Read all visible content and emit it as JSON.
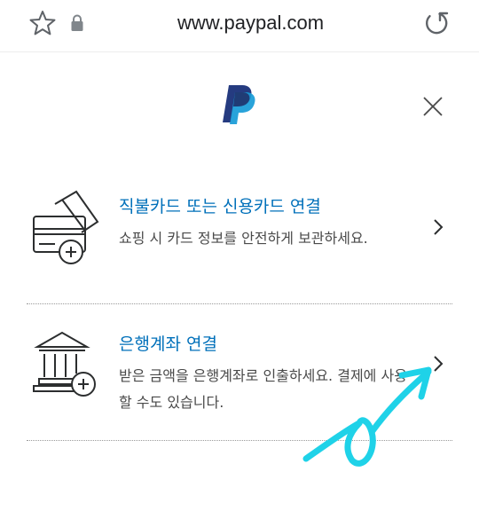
{
  "browser": {
    "url": "www.paypal.com",
    "icons": {
      "favorite": "star-icon",
      "security": "lock-icon",
      "reload": "reload-icon"
    }
  },
  "header": {
    "logo": "paypal-logo",
    "close_icon": "close-icon"
  },
  "options": [
    {
      "title": "직불카드 또는 신용카드 연결",
      "description": "쇼핑 시 카드 정보를 안전하게 보관하세요.",
      "icon": "credit-card-add-icon"
    },
    {
      "title": "은행계좌 연결",
      "description": "받은 금액을 은행계좌로 인출하세요. 결제에 사용할 수도 있습니다.",
      "icon": "bank-add-icon"
    }
  ],
  "colors": {
    "link_blue": "#0070ba",
    "paypal_dark": "#253b80",
    "paypal_light": "#179bd7",
    "annotation": "#1fd2e8"
  }
}
